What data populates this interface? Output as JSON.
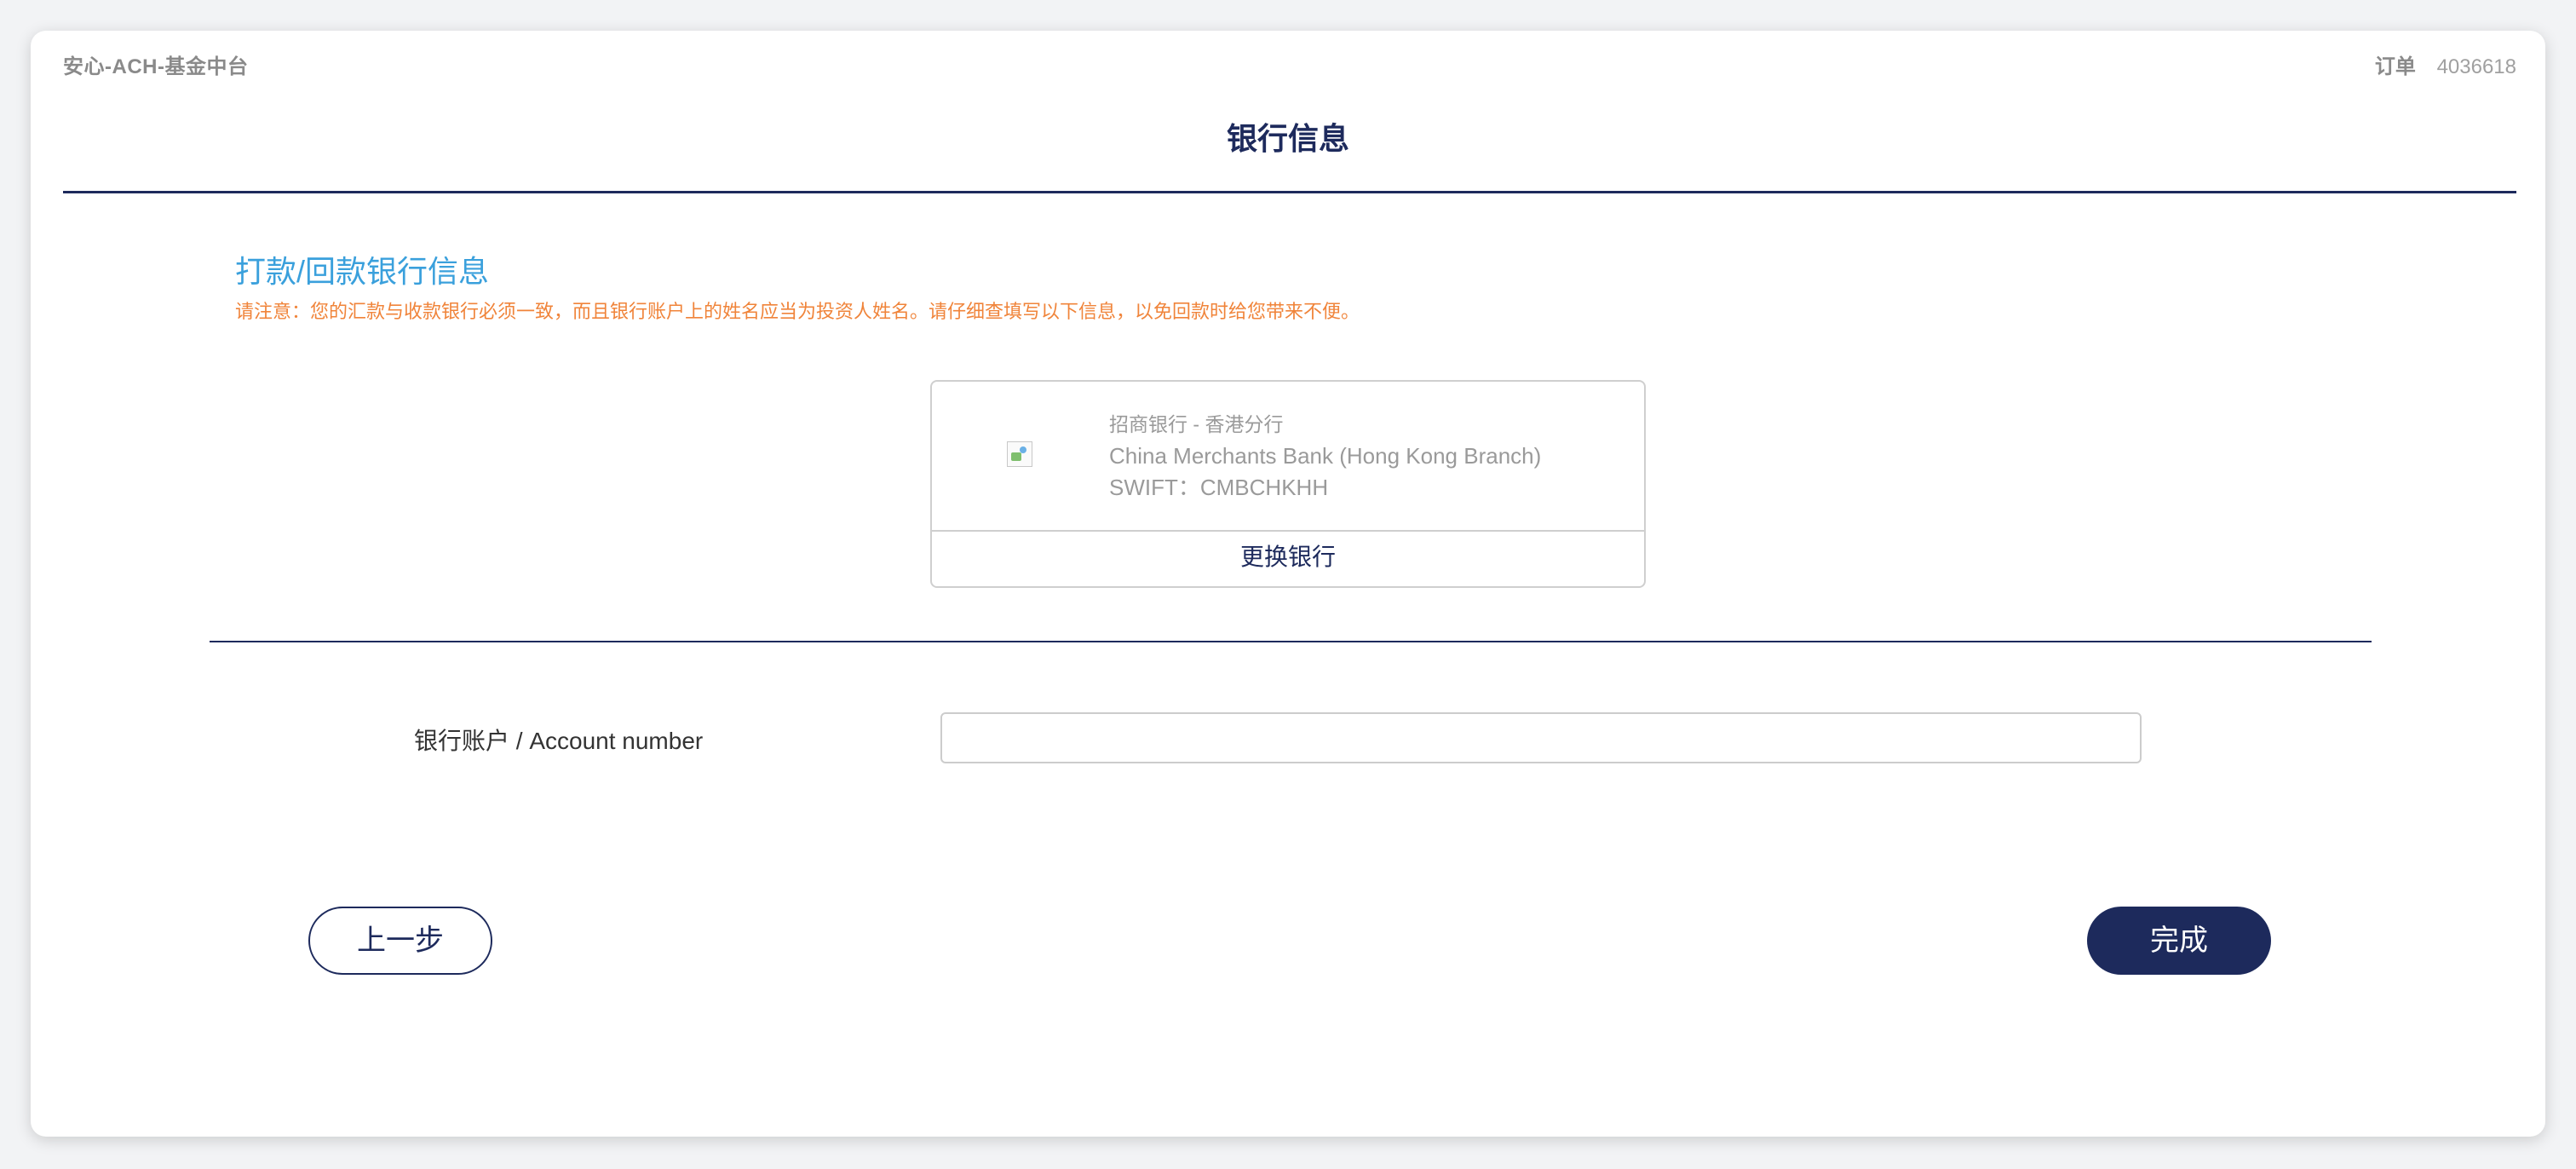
{
  "header": {
    "app_name": "安心-ACH-基金中台",
    "order_label": "订单",
    "order_number": "4036618",
    "page_title": "银行信息"
  },
  "bank_section": {
    "title": "打款/回款银行信息",
    "notice": "请注意：您的汇款与收款银行必须一致，而且银行账户上的姓名应当为投资人姓名。请仔细查填写以下信息，以免回款时给您带来不便。",
    "bank_name_cn": "招商银行 - 香港分行",
    "bank_name_en": "China Merchants Bank (Hong Kong Branch)",
    "swift": "SWIFT：CMBCHKHH",
    "change_bank_label": "更换银行"
  },
  "account": {
    "label": "银行账户 / Account number",
    "value": "",
    "placeholder": ""
  },
  "actions": {
    "prev_label": "上一步",
    "done_label": "完成"
  },
  "colors": {
    "primary": "#1d2a5c",
    "section_title": "#3aa0dc",
    "notice": "#f0843a"
  },
  "icons": {
    "bank_logo": "broken-image-icon"
  }
}
